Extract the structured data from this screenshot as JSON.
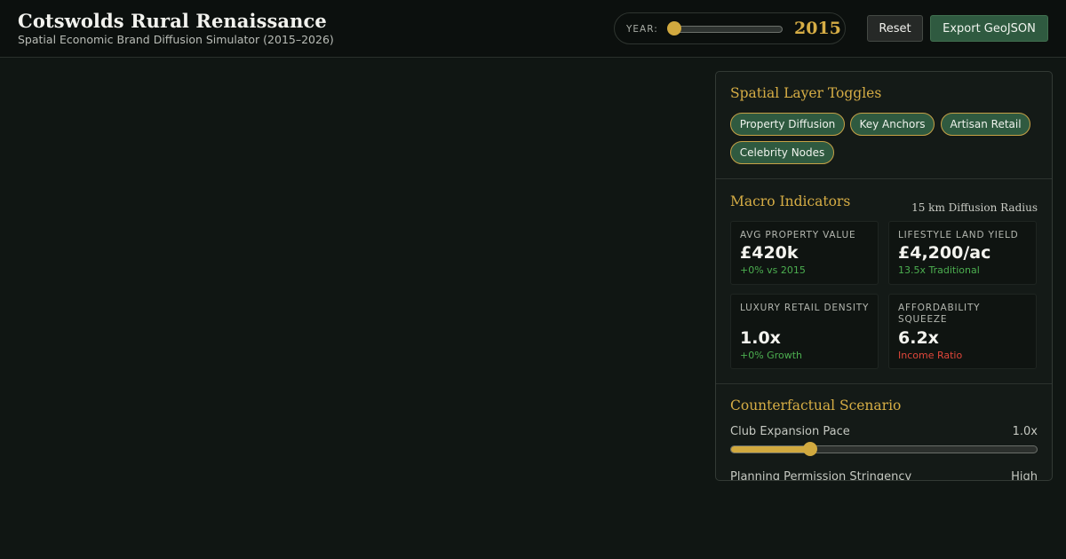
{
  "header": {
    "title": "Cotswolds Rural Renaissance",
    "subtitle": "Spatial Economic Brand Diffusion Simulator (2015–2026)",
    "year_label": "YEAR:",
    "year_value": "2015",
    "year_slider": {
      "min": 2015,
      "max": 2026,
      "value": 2015
    },
    "reset_label": "Reset",
    "export_label": "Export GeoJSON"
  },
  "layers": {
    "title": "Spatial Layer Toggles",
    "chips": [
      {
        "label": "Property Diffusion",
        "active": true
      },
      {
        "label": "Key Anchors",
        "active": true
      },
      {
        "label": "Artisan Retail",
        "active": true
      },
      {
        "label": "Celebrity Nodes",
        "active": true
      }
    ]
  },
  "macro": {
    "title": "Macro Indicators",
    "radius_note": "15 km Diffusion Radius",
    "cards": [
      {
        "label": "AVG PROPERTY VALUE",
        "value": "£420k",
        "delta": "+0% vs 2015",
        "tone": "positive"
      },
      {
        "label": "LIFESTYLE LAND YIELD",
        "value": "£4,200/ac",
        "delta": "13.5x Traditional",
        "tone": "positive"
      },
      {
        "label": "LUXURY RETAIL DENSITY",
        "value": "1.0x",
        "delta": "+0% Growth",
        "tone": "positive"
      },
      {
        "label": "AFFORDABILITY SQUEEZE",
        "value": "6.2x",
        "delta": "Income Ratio",
        "tone": "negative"
      }
    ]
  },
  "counterfactual": {
    "title": "Counterfactual Scenario",
    "pace": {
      "label": "Club Expansion Pace",
      "value": "1.0x",
      "fraction": 0.26
    },
    "planning": {
      "label": "Planning Permission Stringency",
      "value": "High"
    }
  },
  "colors": {
    "accent": "#d6ad45",
    "brand_green": "#2f5a40",
    "positive": "#4caf50",
    "negative": "#e0463a"
  }
}
